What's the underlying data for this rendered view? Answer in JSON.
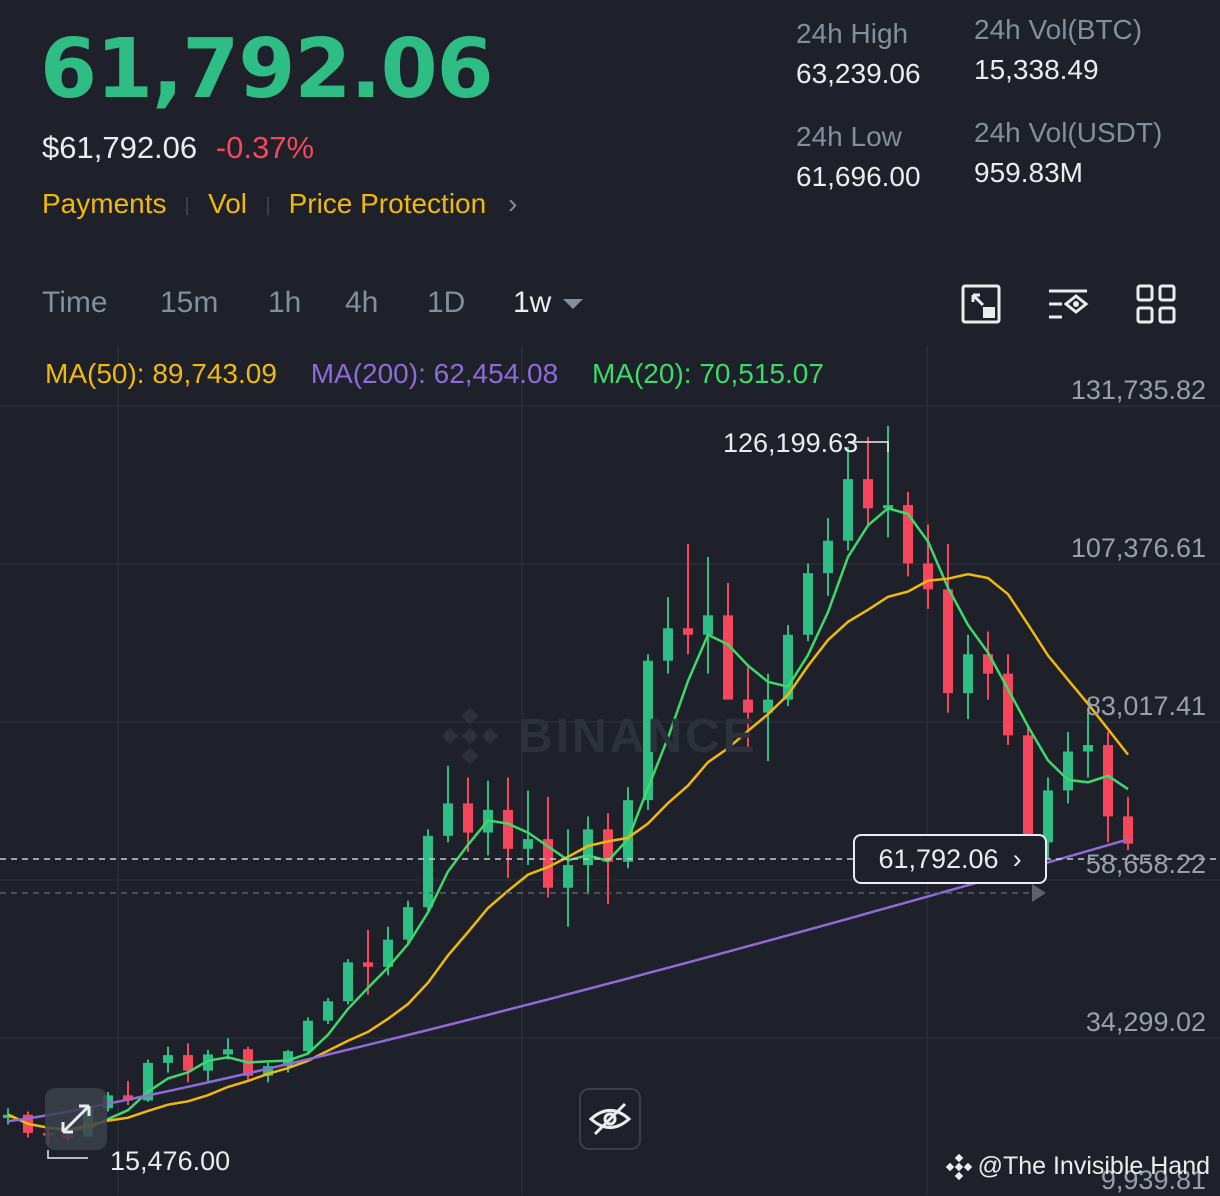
{
  "header": {
    "last_price": "61,792.06",
    "usd_price": "$61,792.06",
    "change_pct": "-0.37%",
    "tags": [
      "Payments",
      "Vol",
      "Price Protection"
    ]
  },
  "stats": {
    "high_label": "24h High",
    "high_value": "63,239.06",
    "low_label": "24h Low",
    "low_value": "61,696.00",
    "vol_btc_label": "24h Vol(BTC)",
    "vol_btc_value": "15,338.49",
    "vol_usdt_label": "24h Vol(USDT)",
    "vol_usdt_value": "959.83M"
  },
  "timeframes": [
    "Time",
    "15m",
    "1h",
    "4h",
    "1D",
    "1w"
  ],
  "active_timeframe": "1w",
  "indicators": {
    "ma50": "MA(50): 89,743.09",
    "ma200": "MA(200): 62,454.08",
    "ma20": "MA(20): 70,515.07"
  },
  "colors": {
    "up": "#2ebd85",
    "down": "#f6465d",
    "ma50": "#f0b90b",
    "ma200": "#8d6cd9",
    "ma20": "#3dd96b",
    "accent": "#f0b90b"
  },
  "icons": [
    "chart-fullscreen-icon",
    "indicator-settings-icon",
    "layout-grid-icon",
    "expand-icon",
    "hide-icon",
    "binance-logo-icon"
  ],
  "axis": {
    "labels": [
      "131,735.82",
      "107,376.61",
      "83,017.41",
      "58,658.22",
      "34,299.02",
      "9,939.81"
    ]
  },
  "annotations": {
    "high": "126,199.63",
    "low": "15,476.00",
    "current": "61,792.06"
  },
  "watermark": "BINANCE",
  "credit": "@The Invisible Hand",
  "chart_data": {
    "type": "candlestick",
    "y_range": [
      9939.81,
      131735.82
    ],
    "candles_approx": [
      [
        19500,
        21000,
        18500,
        20000
      ],
      [
        20000,
        20500,
        16500,
        17200
      ],
      [
        17200,
        18200,
        15476,
        16800
      ],
      [
        16800,
        17500,
        16000,
        16600
      ],
      [
        16600,
        21500,
        16500,
        21000
      ],
      [
        21000,
        23500,
        20500,
        23000
      ],
      [
        23000,
        25200,
        21500,
        22200
      ],
      [
        22200,
        28500,
        22000,
        28000
      ],
      [
        28000,
        30500,
        26500,
        29200
      ],
      [
        29200,
        31000,
        25000,
        26800
      ],
      [
        26800,
        30000,
        25200,
        29300
      ],
      [
        29300,
        31800,
        28500,
        30100
      ],
      [
        30100,
        30500,
        25300,
        26000
      ],
      [
        26000,
        28000,
        25000,
        27500
      ],
      [
        27500,
        30000,
        26500,
        29800
      ],
      [
        29800,
        35000,
        29500,
        34500
      ],
      [
        34500,
        38000,
        34000,
        37500
      ],
      [
        37500,
        44000,
        37000,
        43500
      ],
      [
        43500,
        48500,
        38500,
        42800
      ],
      [
        42800,
        49000,
        41500,
        47000
      ],
      [
        47000,
        53000,
        46500,
        52000
      ],
      [
        52000,
        64000,
        51500,
        63000
      ],
      [
        63000,
        73800,
        62000,
        68000
      ],
      [
        68000,
        72000,
        60500,
        63500
      ],
      [
        63500,
        71500,
        60000,
        67000
      ],
      [
        67000,
        72000,
        56500,
        61000
      ],
      [
        61000,
        70000,
        58500,
        62500
      ],
      [
        62500,
        69000,
        53500,
        55000
      ],
      [
        55000,
        64000,
        49000,
        58500
      ],
      [
        58500,
        66000,
        54000,
        64000
      ],
      [
        64000,
        66500,
        52500,
        59000
      ],
      [
        59000,
        70500,
        58000,
        68500
      ],
      [
        68500,
        91000,
        67000,
        90000
      ],
      [
        90000,
        99800,
        88000,
        95000
      ],
      [
        95000,
        108000,
        91000,
        94000
      ],
      [
        94000,
        106000,
        88000,
        97000
      ],
      [
        97000,
        102000,
        86000,
        84000
      ],
      [
        84000,
        89000,
        76000,
        82000
      ],
      [
        82000,
        88000,
        74500,
        84000
      ],
      [
        84000,
        95500,
        83000,
        94000
      ],
      [
        94000,
        105000,
        93000,
        103500
      ],
      [
        103500,
        112000,
        100000,
        108500
      ],
      [
        108500,
        123000,
        107000,
        118000
      ],
      [
        118000,
        124500,
        111000,
        113500
      ],
      [
        113500,
        126199.63,
        109000,
        114000
      ],
      [
        114000,
        116000,
        103000,
        105000
      ],
      [
        105000,
        111000,
        98000,
        101000
      ],
      [
        101000,
        108000,
        82000,
        85000
      ],
      [
        85000,
        94000,
        81000,
        91000
      ],
      [
        91000,
        94500,
        84000,
        88000
      ],
      [
        88000,
        91000,
        77000,
        78500
      ],
      [
        78500,
        80000,
        60000,
        62000
      ],
      [
        62000,
        72000,
        59500,
        70000
      ],
      [
        70000,
        79000,
        68000,
        76000
      ],
      [
        76000,
        82000,
        72000,
        77000
      ],
      [
        77000,
        79000,
        62000,
        66000
      ],
      [
        66000,
        69000,
        60800,
        61792.06
      ]
    ],
    "series": [
      {
        "name": "MA(50)",
        "last": 89743.09
      },
      {
        "name": "MA(200)",
        "last": 62454.08
      },
      {
        "name": "MA(20)",
        "last": 70515.07
      }
    ]
  }
}
